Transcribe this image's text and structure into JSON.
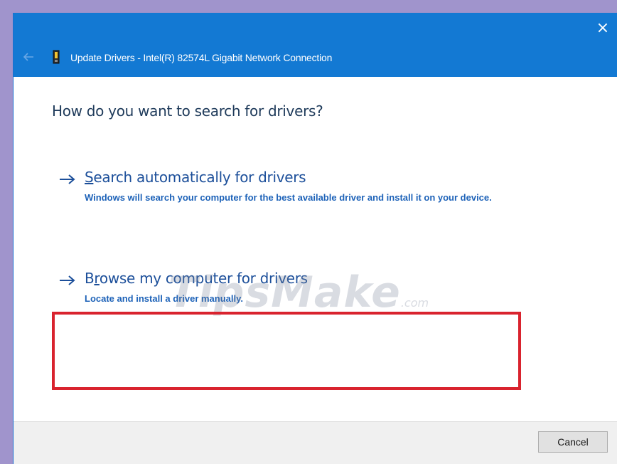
{
  "window": {
    "title": "Update Drivers - Intel(R) 82574L Gigabit Network Connection",
    "close_glyph": "×",
    "back_icon": "back-arrow-icon",
    "device_icon": "network-adapter-icon",
    "accent_color": "#1379d3"
  },
  "main": {
    "question": "How do you want to search for drivers?",
    "options": [
      {
        "accel": "S",
        "title_rest": "earch automatically for drivers",
        "description": "Windows will search your computer for the best available driver and install it on your device.",
        "icon": "arrow-right-icon"
      },
      {
        "title_first": "B",
        "accel": "r",
        "title_rest": "owse my computer for drivers",
        "description": "Locate and install a driver manually.",
        "icon": "arrow-right-icon",
        "highlighted": true
      }
    ]
  },
  "watermark": {
    "brand": "TipsMake",
    "suffix": ".com"
  },
  "footer": {
    "cancel_label": "Cancel"
  },
  "colors": {
    "highlight_border": "#d9232e",
    "link_color": "#1c4f9a",
    "description_color": "#1d62b8"
  }
}
